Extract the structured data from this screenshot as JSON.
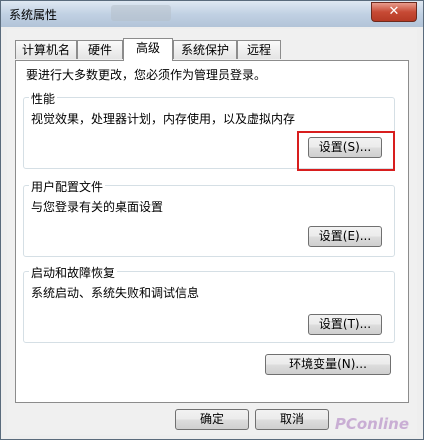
{
  "window": {
    "title": "系统属性",
    "close_label": "✕"
  },
  "tabs": [
    {
      "label": "计算机名"
    },
    {
      "label": "硬件"
    },
    {
      "label": "高级",
      "active": true
    },
    {
      "label": "系统保护"
    },
    {
      "label": "远程"
    }
  ],
  "advanced": {
    "notice": "要进行大多数更改，您必须作为管理员登录。",
    "performance": {
      "label": "性能",
      "desc": "视觉效果，处理器计划，内存使用，以及虚拟内存",
      "button": "设置(S)..."
    },
    "user_profiles": {
      "label": "用户配置文件",
      "desc": "与您登录有关的桌面设置",
      "button": "设置(E)..."
    },
    "startup": {
      "label": "启动和故障恢复",
      "desc": "系统启动、系统失败和调试信息",
      "button": "设置(T)..."
    },
    "env_button": "环境变量(N)..."
  },
  "footer": {
    "ok": "确定",
    "cancel": "取消",
    "watermark": "PConline"
  }
}
